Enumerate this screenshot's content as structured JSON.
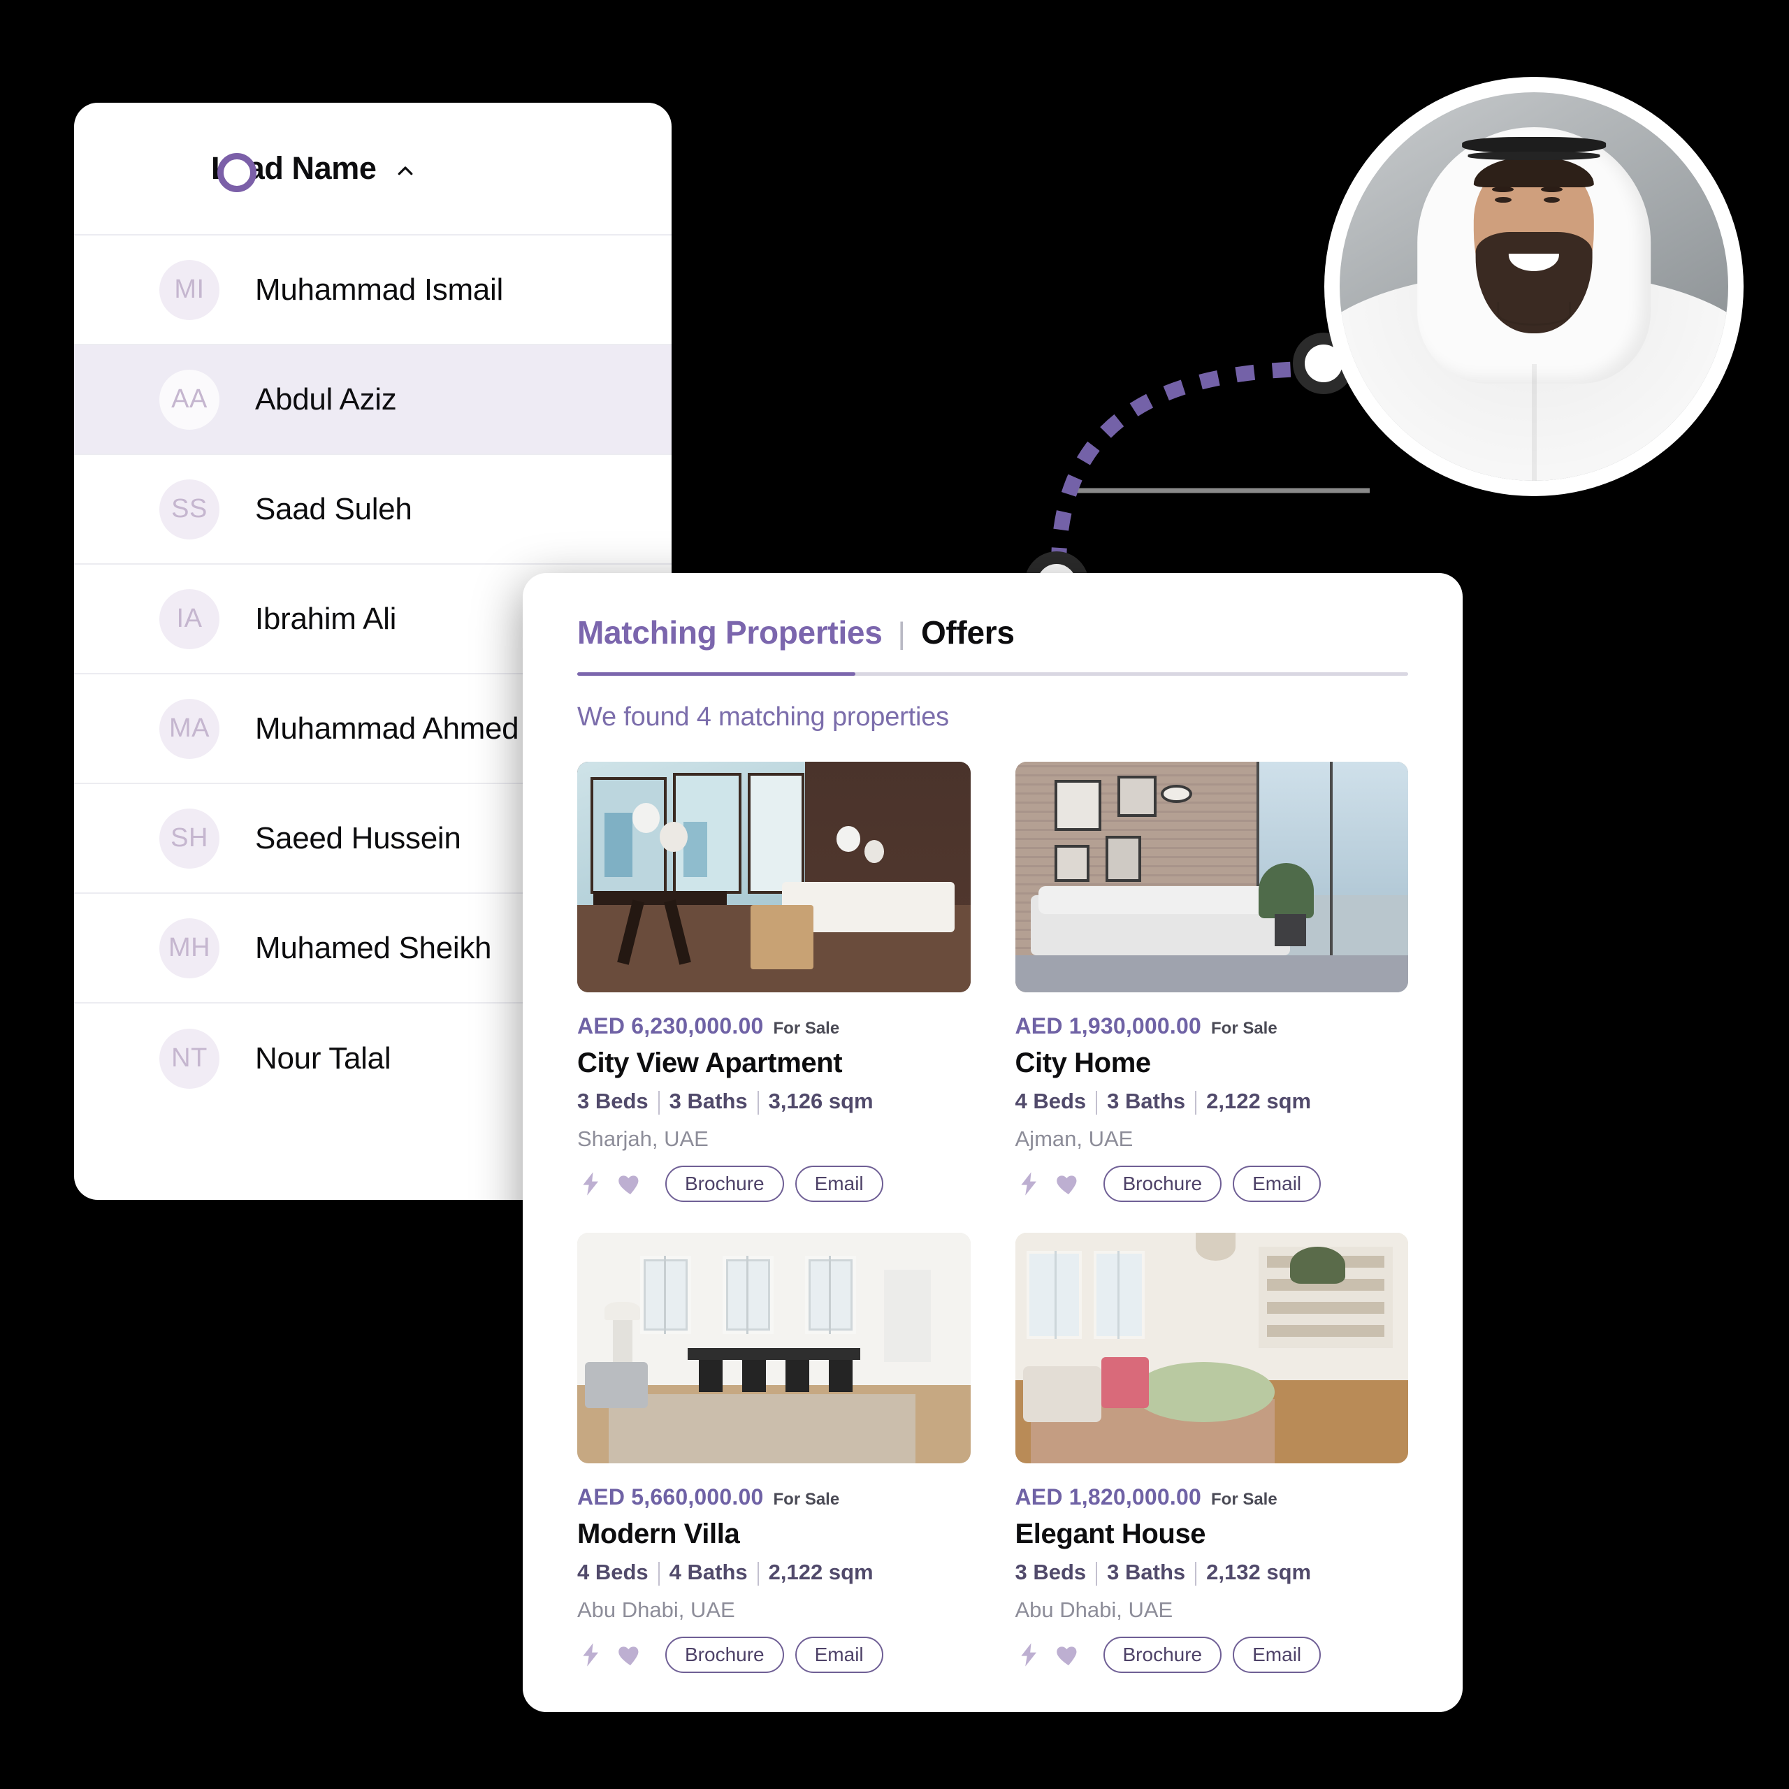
{
  "leads_panel": {
    "header": {
      "title": "Lead Name",
      "sort_icon": "chevron-up-icon",
      "radio_icon": "circle-radio-icon"
    },
    "rows": [
      {
        "initials": "MI",
        "name": "Muhammad Ismail",
        "selected": false
      },
      {
        "initials": "AA",
        "name": "Abdul Aziz",
        "selected": true
      },
      {
        "initials": "SS",
        "name": "Saad Suleh",
        "selected": false
      },
      {
        "initials": "IA",
        "name": "Ibrahim Ali",
        "selected": false
      },
      {
        "initials": "MA",
        "name": "Muhammad Ahmed",
        "selected": false
      },
      {
        "initials": "SH",
        "name": "Saeed Hussein",
        "selected": false
      },
      {
        "initials": "MH",
        "name": "Muhamed Sheikh",
        "selected": false
      },
      {
        "initials": "NT",
        "name": "Nour Talal",
        "selected": false
      }
    ]
  },
  "avatar_photo": {
    "alt": "smiling man in white kandura and ghutra headdress",
    "icon": "user-photo-avatar"
  },
  "connector": {
    "icon": "dashed-curve-connector",
    "dash_color": "#7462a8",
    "node_color": "#2b2b2b",
    "line_color": "#8a8a8a"
  },
  "properties_panel": {
    "tabs": [
      {
        "label": "Matching Properties",
        "active": true
      },
      {
        "label": "Offers",
        "active": false
      }
    ],
    "tab_separator": "|",
    "result_summary": "We found 4 matching properties",
    "accent_color": "#7b66ad",
    "cards": [
      {
        "price": "AED 6,230,000.00",
        "status": "For Sale",
        "title": "City View Apartment",
        "beds": "3 Beds",
        "baths": "3 Baths",
        "area": "3,126 sqm",
        "location": "Sharjah, UAE",
        "actions": {
          "bolt_icon": "lightning-bolt-icon",
          "heart_icon": "heart-icon",
          "brochure": "Brochure",
          "email": "Email"
        }
      },
      {
        "price": "AED 1,930,000.00",
        "status": "For Sale",
        "title": "City Home",
        "beds": "4 Beds",
        "baths": "3 Baths",
        "area": "2,122 sqm",
        "location": "Ajman, UAE",
        "actions": {
          "bolt_icon": "lightning-bolt-icon",
          "heart_icon": "heart-icon",
          "brochure": "Brochure",
          "email": "Email"
        }
      },
      {
        "price": "AED 5,660,000.00",
        "status": "For Sale",
        "title": "Modern Villa",
        "beds": "4 Beds",
        "baths": "4 Baths",
        "area": "2,122 sqm",
        "location": "Abu Dhabi, UAE",
        "actions": {
          "bolt_icon": "lightning-bolt-icon",
          "heart_icon": "heart-icon",
          "brochure": "Brochure",
          "email": "Email"
        }
      },
      {
        "price": "AED 1,820,000.00",
        "status": "For Sale",
        "title": "Elegant House",
        "beds": "3 Beds",
        "baths": "3 Baths",
        "area": "2,132 sqm",
        "location": "Abu Dhabi, UAE",
        "actions": {
          "bolt_icon": "lightning-bolt-icon",
          "heart_icon": "heart-icon",
          "brochure": "Brochure",
          "email": "Email"
        }
      }
    ]
  }
}
